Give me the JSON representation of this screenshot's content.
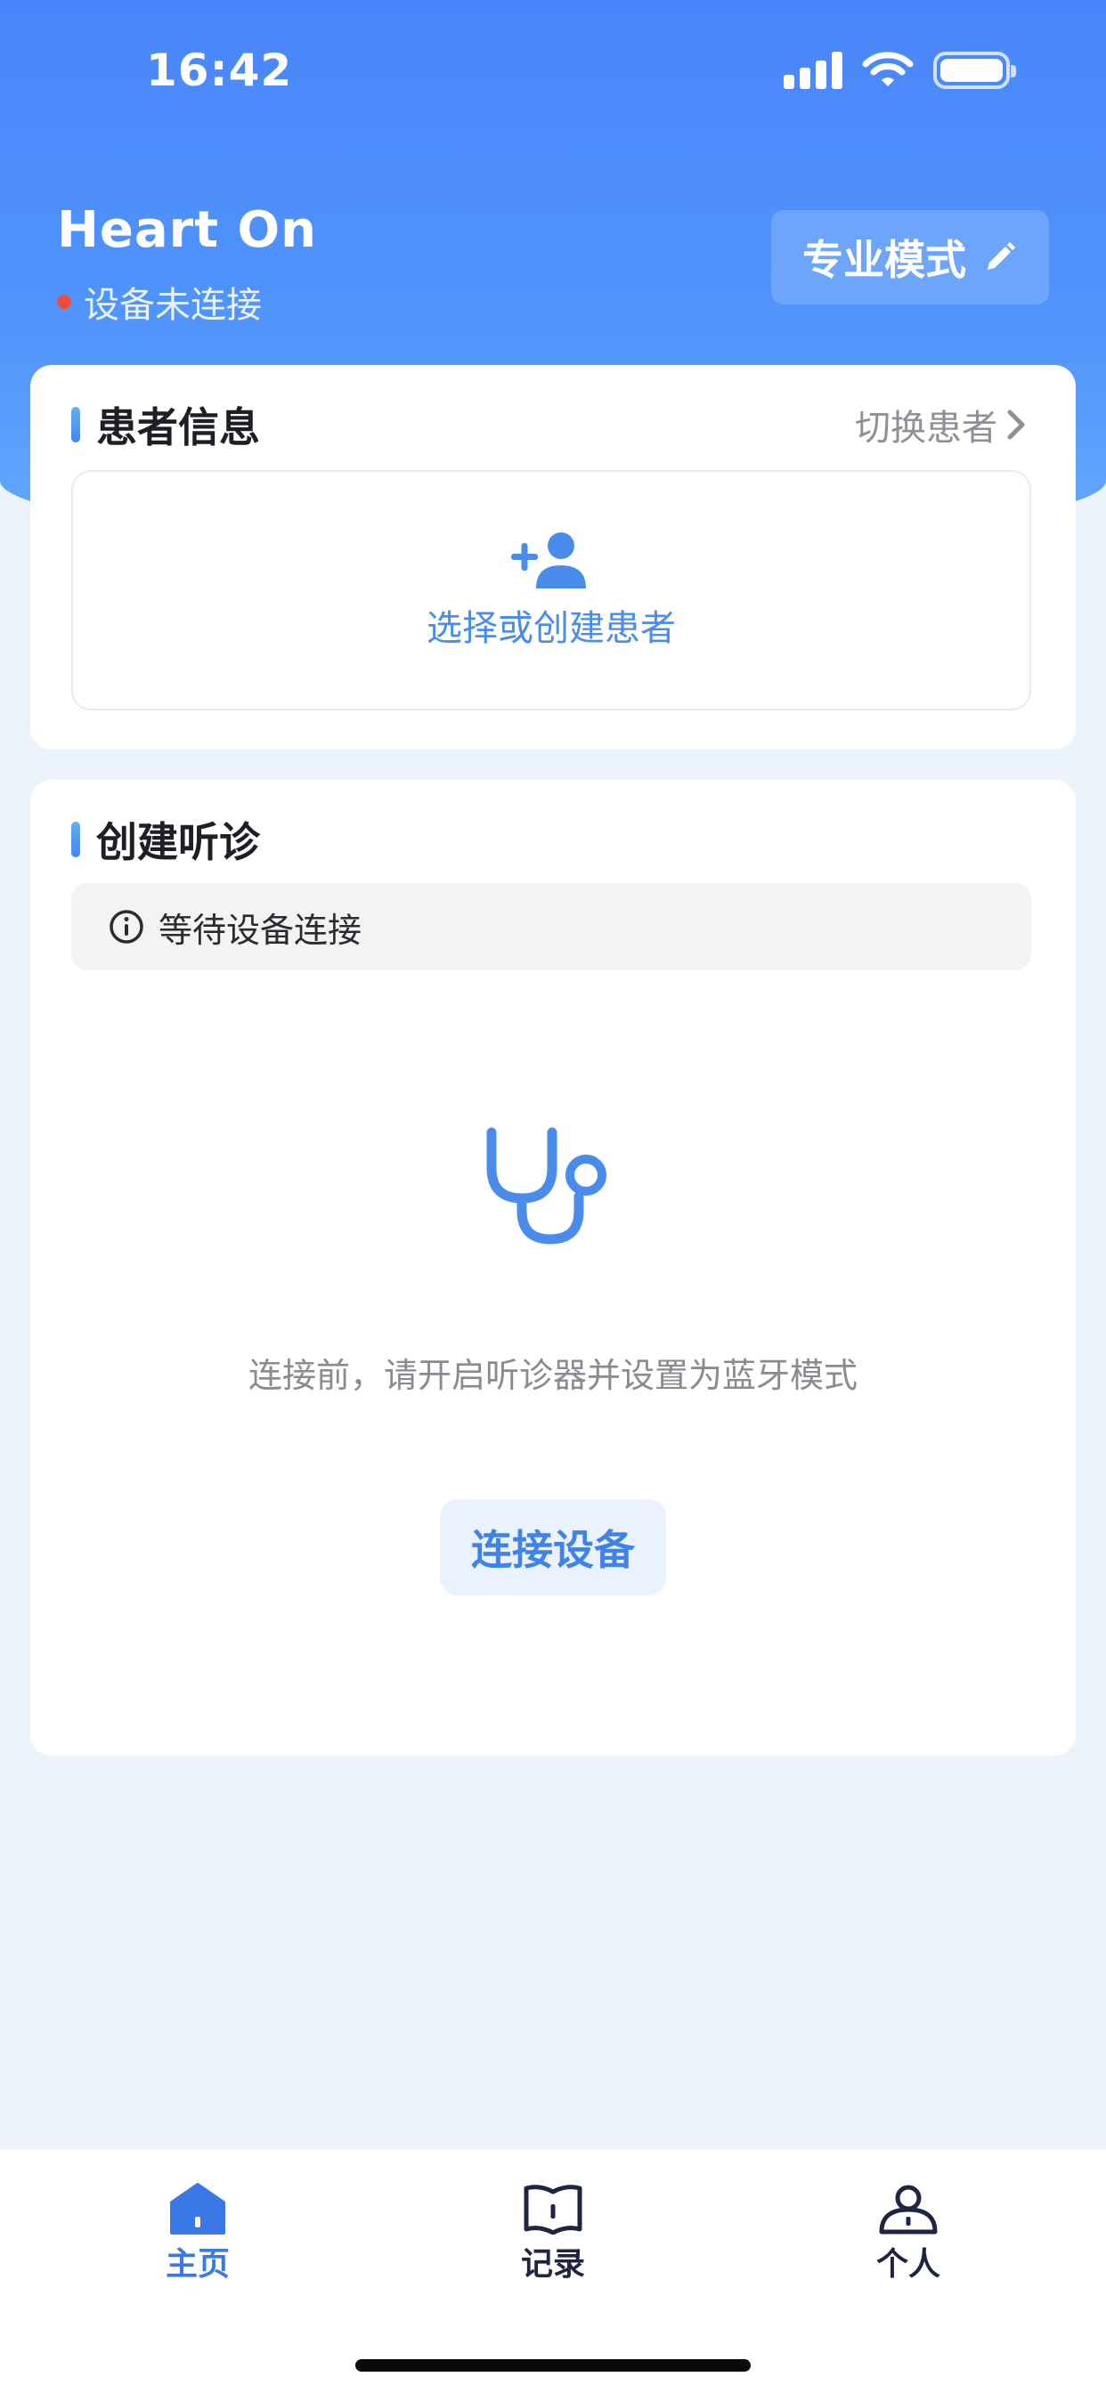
{
  "status_bar": {
    "time": "16:42"
  },
  "header": {
    "app_title": "Heart On",
    "connection_status": "设备未连接",
    "mode_button": "专业模式"
  },
  "patient_card": {
    "title": "患者信息",
    "switch_link": "切换患者",
    "select_label": "选择或创建患者"
  },
  "listen_card": {
    "title": "创建听诊",
    "notice": "等待设备连接",
    "hint": "连接前，请开启听诊器并设置为蓝牙模式",
    "connect_button": "连接设备"
  },
  "tabbar": {
    "items": [
      {
        "label": "主页",
        "icon": "home-icon",
        "active": true
      },
      {
        "label": "记录",
        "icon": "book-icon",
        "active": false
      },
      {
        "label": "个人",
        "icon": "person-icon",
        "active": false
      }
    ]
  },
  "colors": {
    "accent": "#3F82E8",
    "header_gradient_top": "#4A86FB",
    "status_dot": "#F04A3B",
    "background": "#EDF3FB"
  }
}
